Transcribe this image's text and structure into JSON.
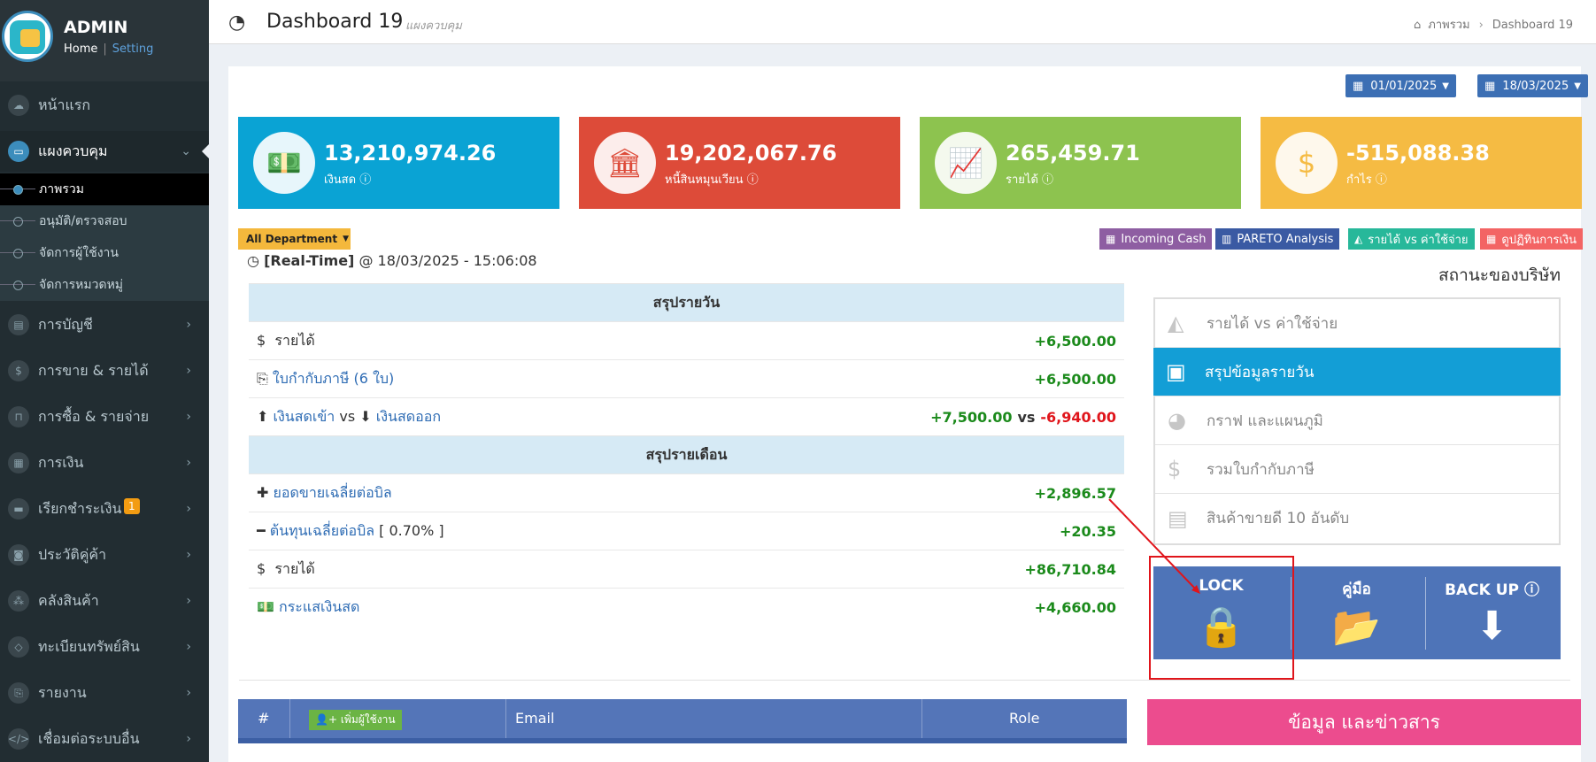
{
  "sidebar": {
    "user": {
      "name": "ADMIN",
      "home": "Home",
      "sep": "|",
      "setting": "Setting"
    },
    "items": [
      {
        "label": "หน้าแรก",
        "icon": "cloud-icon"
      },
      {
        "label": "แผงควบคุม",
        "icon": "monitor-icon",
        "active": true
      },
      {
        "label": "การบัญชี",
        "icon": "book-icon"
      },
      {
        "label": "การขาย & รายได้",
        "icon": "dollar-icon"
      },
      {
        "label": "การซื้อ & รายจ่าย",
        "icon": "cart-icon"
      },
      {
        "label": "การเงิน",
        "icon": "calendar-icon"
      },
      {
        "label": "เรียกชำระเงิน",
        "icon": "card-icon",
        "badge": "1"
      },
      {
        "label": "ประวัติคู่ค้า",
        "icon": "contact-icon"
      },
      {
        "label": "คลังสินค้า",
        "icon": "cubes-icon"
      },
      {
        "label": "ทะเบียนทรัพย์สิน",
        "icon": "diamond-icon"
      },
      {
        "label": "รายงาน",
        "icon": "copy-icon"
      },
      {
        "label": "เชื่อมต่อระบบอื่น",
        "icon": "code-icon"
      }
    ],
    "subitems": [
      {
        "label": "ภาพรวม",
        "active": true
      },
      {
        "label": "อนุมัติ/ตรวจสอบ"
      },
      {
        "label": "จัดการผู้ใช้งาน"
      },
      {
        "label": "จัดการหมวดหมู่"
      }
    ]
  },
  "header": {
    "title": "Dashboard 19",
    "subtitle": "แผงควบคุม",
    "breadcrumb": [
      "ภาพรวม",
      "Dashboard 19"
    ]
  },
  "dates": {
    "from": "01/01/2025",
    "to": "18/03/2025"
  },
  "kpis": [
    {
      "value": "13,210,974.26",
      "label": "เงินสด",
      "color": "#0aa3d4",
      "icon": "money-icon",
      "glyph": "💵"
    },
    {
      "value": "19,202,067.76",
      "label": "หนี้สินหมุนเวียน",
      "color": "#dd4b39",
      "icon": "bank-icon",
      "glyph": "🏛"
    },
    {
      "value": "265,459.71",
      "label": "รายได้",
      "color": "#8dc34f",
      "icon": "chart-line-icon",
      "glyph": "📈"
    },
    {
      "value": "-515,088.38",
      "label": "กำไร",
      "color": "#f5bb43",
      "icon": "dollar-icon",
      "glyph": "$"
    }
  ],
  "department": "All Department",
  "quick_buttons": [
    {
      "label": "Incoming Cash",
      "color": "#8e5ea2"
    },
    {
      "label": "PARETO Analysis",
      "color": "#3a5aa3"
    },
    {
      "label": "รายได้ vs ค่าใช้จ่าย",
      "color": "#27b89a"
    },
    {
      "label": "ดูปฏิทินการเงิน",
      "color": "#f36464"
    }
  ],
  "realtime": {
    "tag": "[Real-Time]",
    "at": "@",
    "timestamp": "18/03/2025 - 15:06:08"
  },
  "daily": {
    "heading": "สรุปรายวัน",
    "rows": [
      {
        "icon": "$",
        "label": "รายได้",
        "value": "+6,500.00"
      },
      {
        "icon": "⎘",
        "label": "ใบกำกับภาษี (6 ใบ)",
        "value": "+6,500.00"
      },
      {
        "cash_in_label": "เงินสดเข้า",
        "vs": "vs",
        "cash_out_label": "เงินสดออก",
        "in": "+7,500.00",
        "out": "-6,940.00"
      }
    ]
  },
  "monthly": {
    "heading": "สรุปรายเดือน",
    "rows": [
      {
        "icon": "✚",
        "label": "ยอดขายเฉลี่ยต่อบิล",
        "value": "+2,896.57"
      },
      {
        "icon": "━",
        "label": "ต้นทุนเฉลี่ยต่อบิล",
        "extra": "[ 0.70% ]",
        "value": "+20.35"
      },
      {
        "icon": "$",
        "label": "รายได้",
        "value": "+86,710.84"
      },
      {
        "icon": "💵",
        "label": "กระแสเงินสด",
        "value": "+4,660.00"
      }
    ]
  },
  "company": {
    "title": "สถานะของบริษัท",
    "menu": [
      {
        "label": "รายได้ vs ค่าใช้จ่าย",
        "icon": "area-chart-icon"
      },
      {
        "label": "สรุปข้อมูลรายวัน",
        "icon": "calendar-plus-icon",
        "active": true
      },
      {
        "label": "กราฟ และแผนภูมิ",
        "icon": "pie-chart-icon"
      },
      {
        "label": "รวมใบกำกับภาษี",
        "icon": "dollar-icon"
      },
      {
        "label": "สินค้าขายดี 10 อันดับ",
        "icon": "newspaper-icon"
      }
    ]
  },
  "tools": [
    {
      "label": "LOCK",
      "icon": "lock-icon"
    },
    {
      "label": "คู่มือ",
      "icon": "folder-open-icon"
    },
    {
      "label": "BACK UP",
      "icon": "download-icon"
    }
  ],
  "user_table": {
    "hash": "#",
    "add_user": "เพิ่มผู้ใช้งาน",
    "email": "Email",
    "role": "Role"
  },
  "news_title": "ข้อมูล และข่าวสาร"
}
